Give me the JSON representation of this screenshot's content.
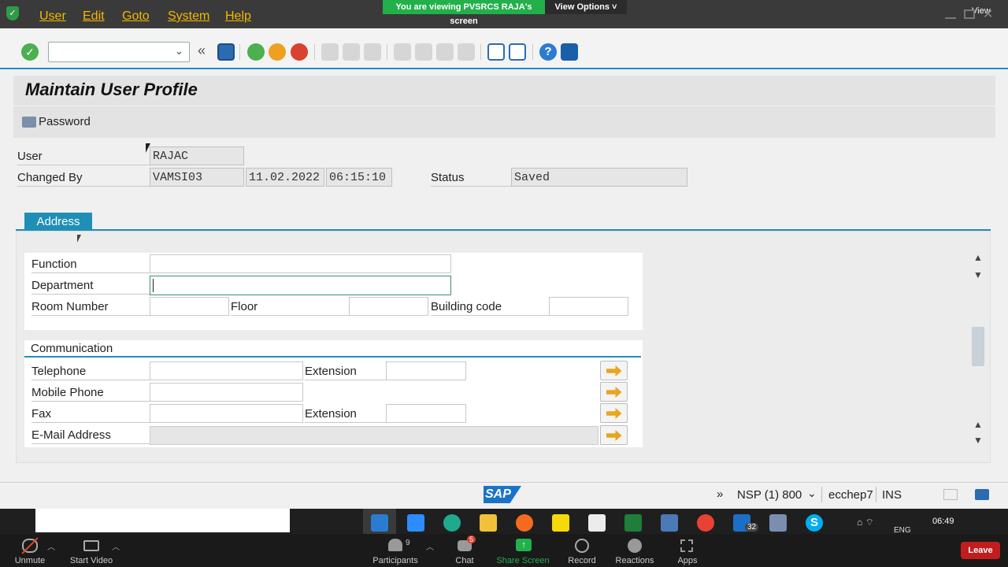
{
  "menu": {
    "items": [
      "User",
      "Edit",
      "Goto",
      "System",
      "Help"
    ]
  },
  "share_banner": {
    "viewing": "You are viewing PVSRCS RAJA's screen",
    "options": "View Options ˅",
    "view": "View"
  },
  "toolbar": {
    "command_placeholder": ""
  },
  "page": {
    "title": "Maintain User Profile",
    "password_label": "Password"
  },
  "header_fields": {
    "user_label": "User",
    "user_value": "RAJAC",
    "changed_by_label": "Changed By",
    "changed_by_value": "VAMSI03",
    "changed_date": "11.02.2022",
    "changed_time": "06:15:10",
    "status_label": "Status",
    "status_value": "Saved"
  },
  "tabs": [
    {
      "label": "Address"
    }
  ],
  "address": {
    "function_label": "Function",
    "function_value": "",
    "department_label": "Department",
    "department_value": "",
    "room_label": "Room Number",
    "floor_label": "Floor",
    "building_label": "Building code"
  },
  "communication": {
    "section_title": "Communication",
    "telephone_label": "Telephone",
    "extension_label": "Extension",
    "mobile_label": "Mobile Phone",
    "fax_label": "Fax",
    "fax_extension_label": "Extension",
    "email_label": "E-Mail Address"
  },
  "statusbar": {
    "logo": "SAP",
    "arrows": "»",
    "system": "NSP (1) 800",
    "server": "ecchep7",
    "mode": "INS"
  },
  "taskbar": {
    "time": "06:49",
    "lang": "ENG",
    "mail_badge": "32"
  },
  "zoom": {
    "unmute": "Unmute",
    "start_video": "Start Video",
    "participants": "Participants",
    "participants_count": "9",
    "chat": "Chat",
    "chat_badge": "5",
    "share": "Share Screen",
    "record": "Record",
    "reactions": "Reactions",
    "apps": "Apps",
    "leave": "Leave"
  },
  "colors": {
    "accent": "#1f8fb5",
    "menu_text": "#f5b800",
    "share_green": "#22b04a",
    "leave_red": "#c21d1d"
  }
}
